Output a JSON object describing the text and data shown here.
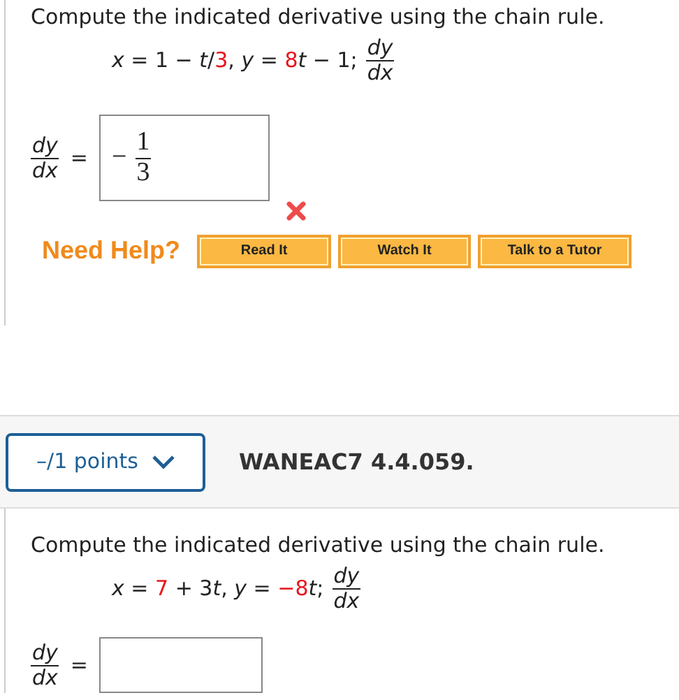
{
  "questions": [
    {
      "prompt": "Compute the indicated derivative using the chain rule.",
      "equation": [
        {
          "text": "*x* = 1 − *t*/",
          "highlighted": false
        },
        {
          "text": "3",
          "highlighted": true
        },
        {
          "text": ", *y* = ",
          "highlighted": false
        },
        {
          "text": "8",
          "highlighted": true
        },
        {
          "text": "*t* − 1;",
          "highlighted": false
        }
      ],
      "equation_fraction": {
        "numerator": "dy",
        "denominator": "dx"
      },
      "answer_label": {
        "numerator": "dy",
        "denominator": "dx",
        "equals": "="
      },
      "answer": {
        "sign": "−",
        "numerator": "1",
        "denominator": "3"
      },
      "incorrect": true,
      "help": {
        "label": "Need Help?",
        "buttons": [
          "Read It",
          "Watch It",
          "Talk to a Tutor"
        ]
      }
    },
    {
      "header": {
        "points": "–/1 points",
        "code": "WANEAC7 4.4.059."
      },
      "prompt": "Compute the indicated derivative using the chain rule.",
      "equation": [
        {
          "text": "*x* = ",
          "highlighted": false
        },
        {
          "text": "7",
          "highlighted": true
        },
        {
          "text": " + 3",
          "highlighted": false
        },
        {
          "text": "*t*, *y* = ",
          "highlighted": false
        },
        {
          "text": "−8",
          "highlighted": true
        },
        {
          "text": "*t*;",
          "highlighted": false
        }
      ],
      "equation_fraction": {
        "numerator": "dy",
        "denominator": "dx"
      },
      "answer_label": {
        "numerator": "dy",
        "denominator": "dx",
        "equals": "="
      },
      "incorrect": false
    }
  ]
}
